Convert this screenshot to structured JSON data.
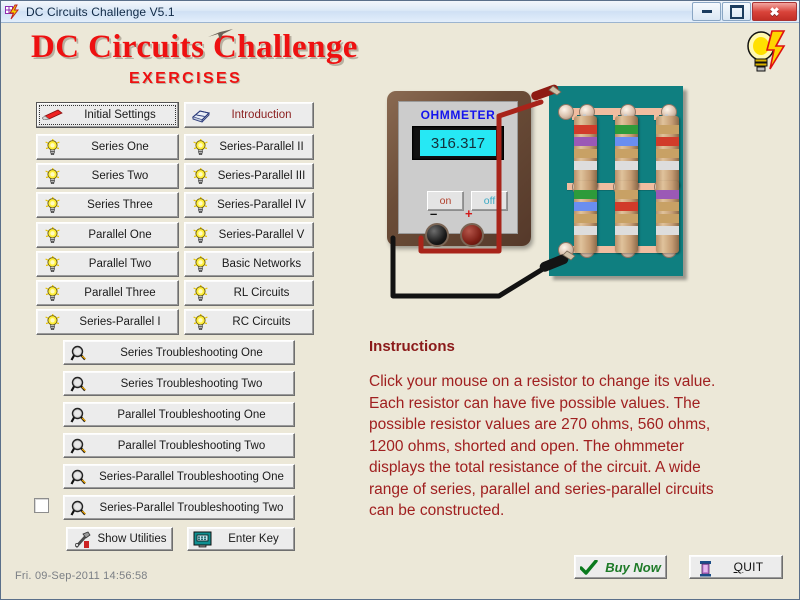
{
  "window": {
    "title": "DC Circuits Challenge V5.1",
    "icon": "app-bolt-icon",
    "controls": {
      "minimize": "minimize",
      "maximize": "maximize",
      "close": "✖"
    }
  },
  "header": {
    "title": "DC Circuits Challenge",
    "subtitle": "EXERCISES",
    "logo_icon": "lightbulb-lightning-icon",
    "title_color": "#ee1111"
  },
  "left_column": [
    {
      "label": "Initial Settings",
      "icon": "marker-icon",
      "focused": true
    },
    {
      "label": "Series One",
      "icon": "lightbulb-icon"
    },
    {
      "label": "Series Two",
      "icon": "lightbulb-icon"
    },
    {
      "label": "Series Three",
      "icon": "lightbulb-icon"
    },
    {
      "label": "Parallel One",
      "icon": "lightbulb-icon"
    },
    {
      "label": "Parallel Two",
      "icon": "lightbulb-icon"
    },
    {
      "label": "Parallel Three",
      "icon": "lightbulb-icon"
    },
    {
      "label": "Series-Parallel I",
      "icon": "lightbulb-icon"
    }
  ],
  "right_column": [
    {
      "label": "Introduction",
      "icon": "book-icon",
      "color": "#8b2020"
    },
    {
      "label": "Series-Parallel II",
      "icon": "lightbulb-icon"
    },
    {
      "label": "Series-Parallel III",
      "icon": "lightbulb-icon"
    },
    {
      "label": "Series-Parallel  IV",
      "icon": "lightbulb-icon"
    },
    {
      "label": "Series-Parallel  V",
      "icon": "lightbulb-icon"
    },
    {
      "label": "Basic Networks",
      "icon": "lightbulb-icon"
    },
    {
      "label": "RL Circuits",
      "icon": "lightbulb-icon"
    },
    {
      "label": "RC Circuits",
      "icon": "lightbulb-icon"
    }
  ],
  "troubleshooting": [
    {
      "label": "Series Troubleshooting One",
      "icon": "magnifier-icon"
    },
    {
      "label": "Series Troubleshooting Two",
      "icon": "magnifier-icon"
    },
    {
      "label": "Parallel Troubleshooting One",
      "icon": "magnifier-icon"
    },
    {
      "label": "Parallel Troubleshooting Two",
      "icon": "magnifier-icon"
    },
    {
      "label": "Series-Parallel Troubleshooting One",
      "icon": "magnifier-icon"
    },
    {
      "label": "Series-Parallel Troubleshooting Two",
      "icon": "magnifier-icon"
    }
  ],
  "utility_row": [
    {
      "label": "Show Utilities",
      "icon": "tools-icon"
    },
    {
      "label": "Enter Key",
      "icon": "keypad-icon"
    }
  ],
  "checkbox": {
    "checked": false
  },
  "status": {
    "datetime": "Fri.  09-Sep-2011    14:56:58"
  },
  "ohmmeter": {
    "title": "OHMMETER",
    "reading": "316.317",
    "lcd_color": "#26e8f4",
    "buttons": [
      {
        "label": "on",
        "color": "#b0402c"
      },
      {
        "label": "off",
        "color": "#3aa9c4"
      }
    ],
    "terminals": [
      {
        "label": "–",
        "name": "negative"
      },
      {
        "label": "+",
        "name": "positive"
      }
    ]
  },
  "circuit_board": {
    "board_color": "#0f7f80",
    "trace_color": "#f0bda0",
    "resistors": [
      {
        "position": "top-left",
        "bands": [
          "#d13b2a",
          "#9b59b6",
          "#c8a165",
          "#dddddd"
        ]
      },
      {
        "position": "top-center",
        "bands": [
          "#2e9b3a",
          "#6a8ef0",
          "#c8a165",
          "#dddddd"
        ]
      },
      {
        "position": "top-right",
        "bands": [
          "#c8a165",
          "#d13b2a",
          "#c8a165",
          "#dddddd"
        ]
      },
      {
        "position": "bottom-left",
        "bands": [
          "#2e9b3a",
          "#6a8ef0",
          "#c8a165",
          "#dddddd"
        ]
      },
      {
        "position": "bottom-center",
        "bands": [
          "#c8a165",
          "#d13b2a",
          "#c8a165",
          "#dddddd"
        ]
      },
      {
        "position": "bottom-right",
        "bands": [
          "#9b59b6",
          "#c8a165",
          "#c8a165",
          "#dddddd"
        ]
      }
    ],
    "probes": [
      {
        "name": "negative-probe",
        "color": "#111111"
      },
      {
        "name": "positive-probe",
        "color": "#a8241a"
      }
    ]
  },
  "instructions": {
    "heading": "Instructions",
    "body": "Click your mouse on a resistor to change its value. Each resistor can have five possible values. The possible resistor values are 270 ohms, 560 ohms, 1200 ohms, shorted and open. The ohmmeter displays the total resistance of the circuit. A wide range of series, parallel and series-parallel circuits can be constructed.",
    "color": "#a02020"
  },
  "footer": {
    "buy": {
      "label": "Buy Now",
      "icon": "checkmark-icon",
      "color": "#1d7a28"
    },
    "quit": {
      "label_prefix": "Q",
      "label_rest": "UIT",
      "icon": "door-icon"
    }
  }
}
